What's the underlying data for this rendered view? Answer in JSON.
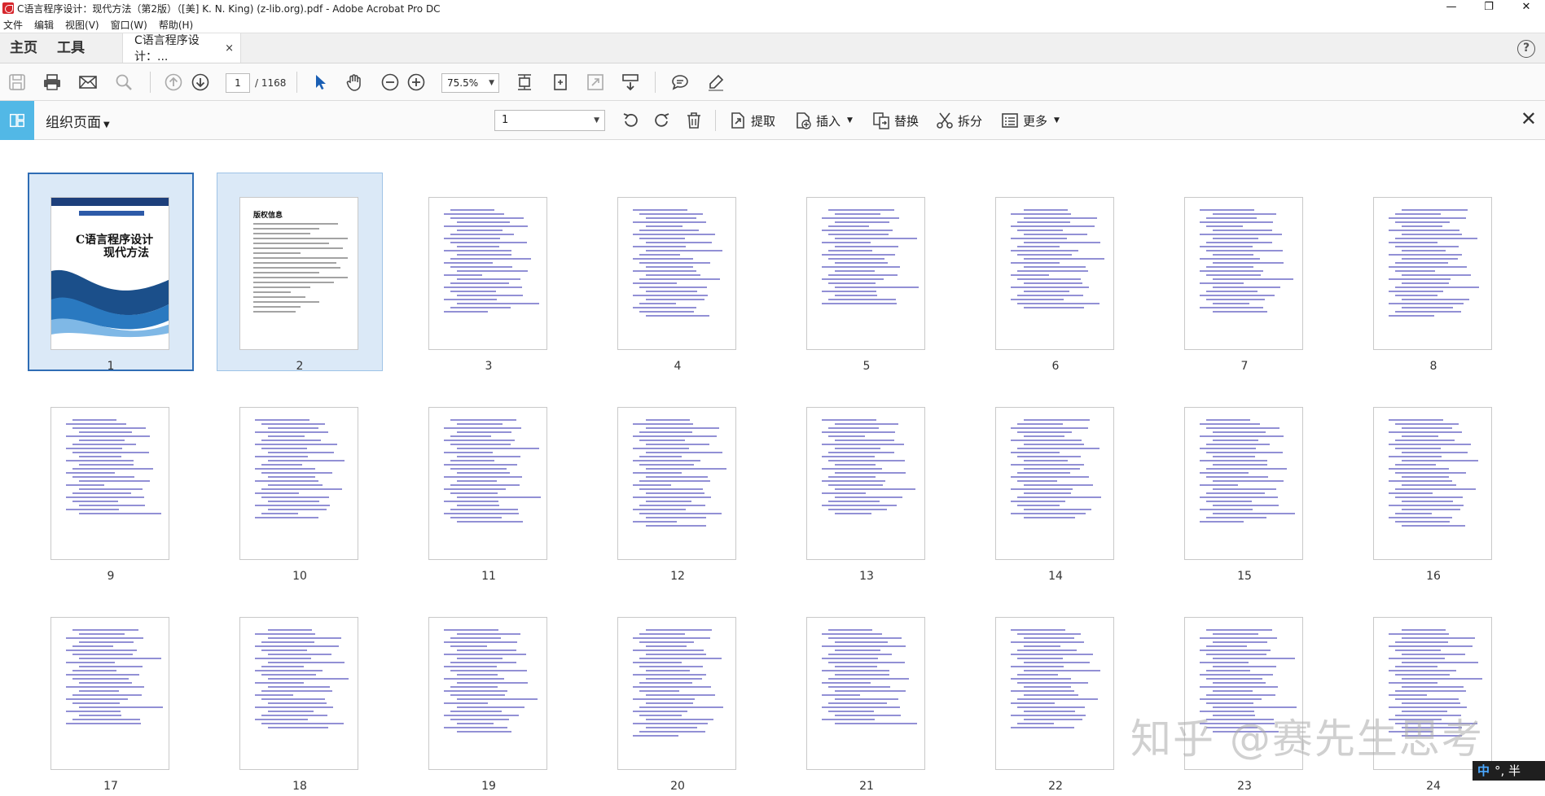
{
  "window": {
    "title": "C语言程序设计：现代方法（第2版）（[美] K. N. King) (z-lib.org).pdf - Adobe Acrobat Pro DC",
    "controls": [
      "—",
      "❐",
      "✕"
    ]
  },
  "menu": [
    "文件",
    "编辑",
    "视图(V)",
    "窗口(W)",
    "帮助(H)"
  ],
  "tabs": {
    "home": "主页",
    "tools": "工具",
    "document": "C语言程序设计：...",
    "close": "×",
    "help": "?"
  },
  "toolbar": {
    "page_current": "1",
    "page_total": "/ 1168",
    "zoom": "75.5%"
  },
  "organize": {
    "title": "组织页面",
    "range": "1",
    "extract": "提取",
    "insert": "插入",
    "replace": "替换",
    "split": "拆分",
    "more": "更多"
  },
  "thumbnails": [
    {
      "label": "1"
    },
    {
      "label": "2"
    },
    {
      "label": "3"
    },
    {
      "label": "4"
    },
    {
      "label": "5"
    },
    {
      "label": "6"
    },
    {
      "label": "7"
    },
    {
      "label": "8"
    },
    {
      "label": "9"
    },
    {
      "label": "10"
    },
    {
      "label": "11"
    },
    {
      "label": "12"
    },
    {
      "label": "13"
    },
    {
      "label": "14"
    },
    {
      "label": "15"
    },
    {
      "label": "16"
    },
    {
      "label": "17"
    },
    {
      "label": "18"
    },
    {
      "label": "19"
    },
    {
      "label": "20"
    },
    {
      "label": "21"
    },
    {
      "label": "22"
    },
    {
      "label": "23"
    },
    {
      "label": "24"
    }
  ],
  "cover": {
    "title_line1": "C语言程序设计",
    "title_line2": "现代方法"
  },
  "copyright_page": {
    "heading": "版权信息"
  },
  "watermark": "知乎 @赛先生思考",
  "ime": {
    "lang": "中",
    "rest": "°, 半"
  },
  "colors": {
    "accent": "#52b8e6",
    "selection": "#dbe9f7",
    "toc_text": "#6e6bc7"
  }
}
